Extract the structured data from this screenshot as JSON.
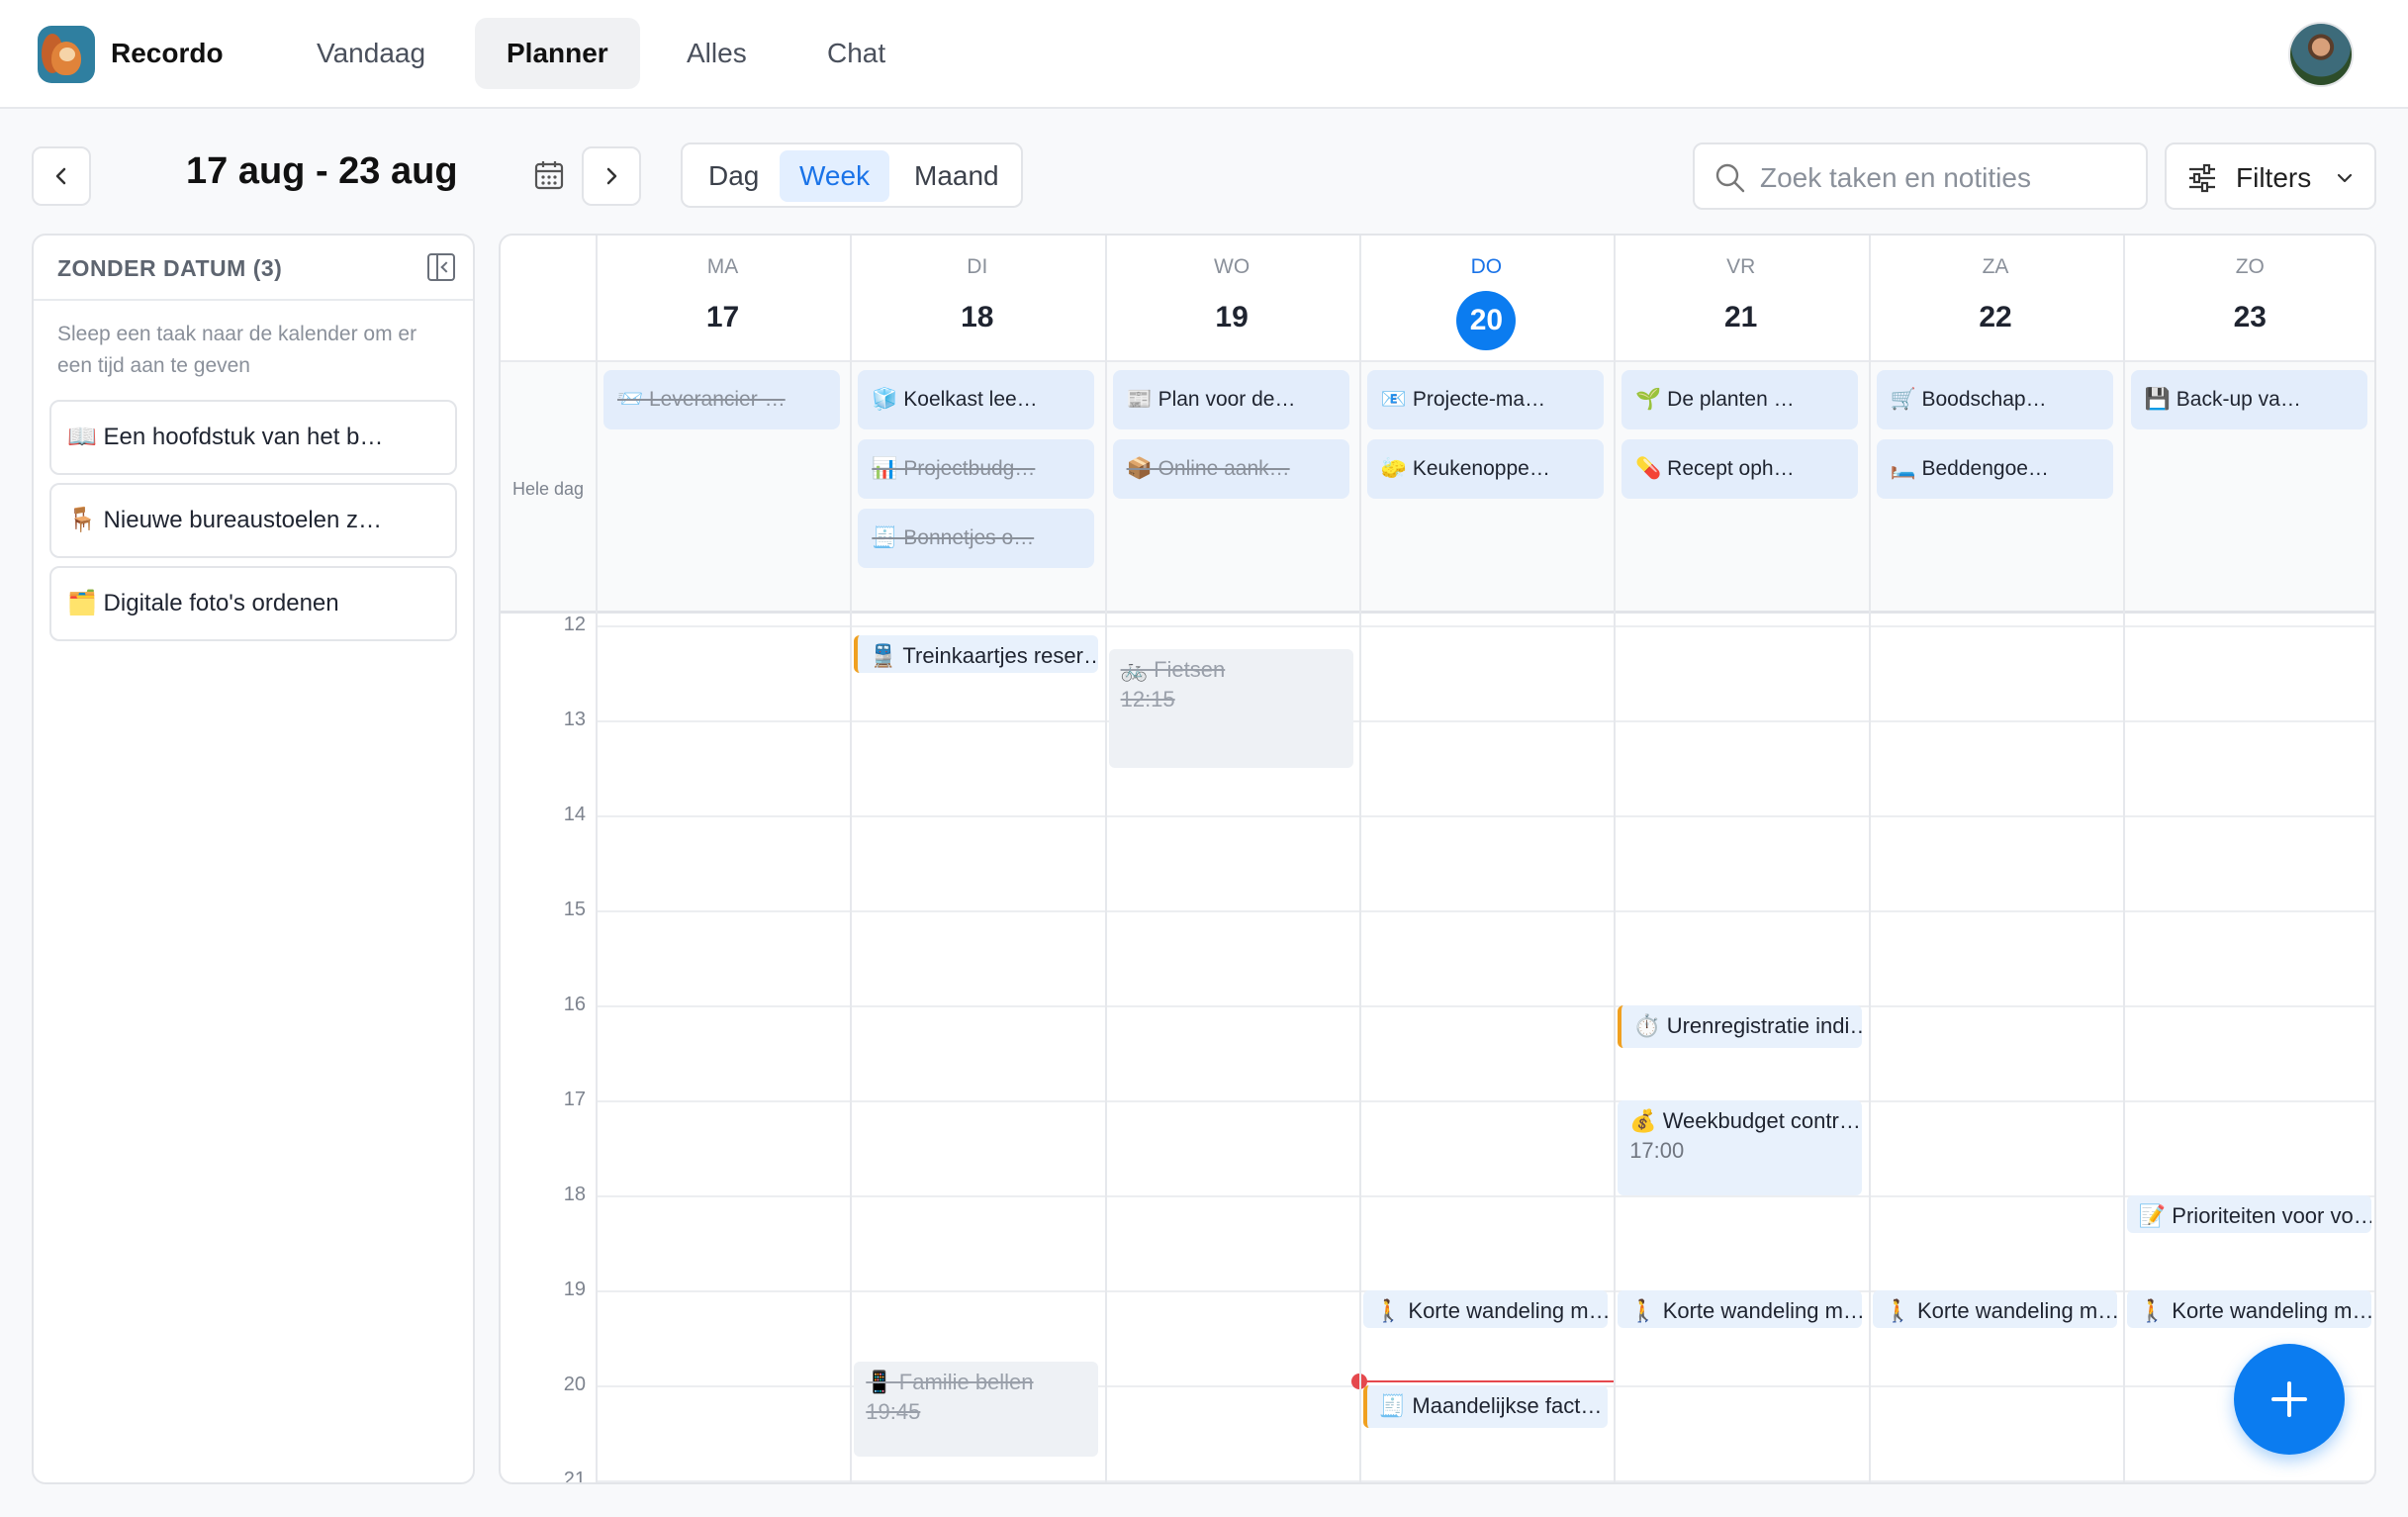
{
  "app": {
    "name": "Recordo"
  },
  "nav": {
    "items": [
      "Vandaag",
      "Planner",
      "Alles",
      "Chat"
    ],
    "active": "Planner"
  },
  "toolbar": {
    "date_range": "17 aug - 23 aug",
    "views": [
      "Dag",
      "Week",
      "Maand"
    ],
    "active_view": "Week",
    "search_placeholder": "Zoek taken en notities",
    "filters_label": "Filters"
  },
  "sidebar": {
    "title": "ZONDER DATUM (3)",
    "hint": "Sleep een taak naar de kalender om er een tijd aan te geven",
    "items": [
      "📖 Een hoofdstuk van het b…",
      "🪑 Nieuwe bureaustoelen z…",
      "🗂️ Digitale foto's ordenen"
    ]
  },
  "calendar": {
    "days": [
      {
        "name": "MA",
        "date": "17"
      },
      {
        "name": "DI",
        "date": "18"
      },
      {
        "name": "WO",
        "date": "19"
      },
      {
        "name": "DO",
        "date": "20",
        "today": true
      },
      {
        "name": "VR",
        "date": "21"
      },
      {
        "name": "ZA",
        "date": "22"
      },
      {
        "name": "ZO",
        "date": "23"
      }
    ],
    "all_day_label": "Hele dag",
    "all_day": [
      [
        {
          "text": "📨 Leverancier-…",
          "done": true
        }
      ],
      [
        {
          "text": "🧊 Koelkast lee…",
          "done": false
        },
        {
          "text": "📊 Projectbudg…",
          "done": true
        },
        {
          "text": "🧾 Bonnetjes o…",
          "done": true
        }
      ],
      [
        {
          "text": "📰 Plan voor de…",
          "done": false
        },
        {
          "text": "📦 Online aank…",
          "done": true
        }
      ],
      [
        {
          "text": "📧 Projecte-ma…",
          "done": false
        },
        {
          "text": "🧽 Keukenoppe…",
          "done": false
        }
      ],
      [
        {
          "text": "🌱 De planten …",
          "done": false
        },
        {
          "text": "💊 Recept oph…",
          "done": false
        }
      ],
      [
        {
          "text": "🛒 Boodschap…",
          "done": false
        },
        {
          "text": "🛏️ Beddengoe…",
          "done": false
        }
      ],
      [
        {
          "text": "💾 Back-up va…",
          "done": false
        }
      ]
    ],
    "hours": [
      "12",
      "13",
      "14",
      "15",
      "16",
      "17",
      "18",
      "19",
      "20",
      "21"
    ],
    "events": [
      {
        "day": 1,
        "start": 12.1,
        "end": 12.5,
        "text": "🚆 Treinkaartjes reser…",
        "accent": true
      },
      {
        "day": 2,
        "start": 12.25,
        "end": 13.5,
        "text": "🚲 Fietsen",
        "time": "12:15",
        "done": true
      },
      {
        "day": 4,
        "start": 16.0,
        "end": 16.45,
        "text": "⏱️ Urenregistratie indi…",
        "accent": true
      },
      {
        "day": 4,
        "start": 17.0,
        "end": 18.0,
        "text": "💰 Weekbudget contr…",
        "time": "17:00"
      },
      {
        "day": 6,
        "start": 18.0,
        "end": 18.4,
        "text": "📝 Prioriteiten voor vo…"
      },
      {
        "day": 3,
        "start": 19.0,
        "end": 19.4,
        "text": "🚶 Korte wandeling m…"
      },
      {
        "day": 4,
        "start": 19.0,
        "end": 19.4,
        "text": "🚶 Korte wandeling m…"
      },
      {
        "day": 5,
        "start": 19.0,
        "end": 19.4,
        "text": "🚶 Korte wandeling m…"
      },
      {
        "day": 6,
        "start": 19.0,
        "end": 19.4,
        "text": "🚶 Korte wandeling m…"
      },
      {
        "day": 1,
        "start": 19.75,
        "end": 20.75,
        "text": "📱 Familie bellen",
        "time": "19:45",
        "done": true
      },
      {
        "day": 3,
        "start": 20.0,
        "end": 20.45,
        "text": "🧾 Maandelijkse fact…",
        "accent": true
      }
    ],
    "now": {
      "day": 3,
      "hour": 19.95
    }
  },
  "colors": {
    "accent": "#0b7cf0",
    "now_line": "#e5484d",
    "event_accent": "#f0a020"
  }
}
